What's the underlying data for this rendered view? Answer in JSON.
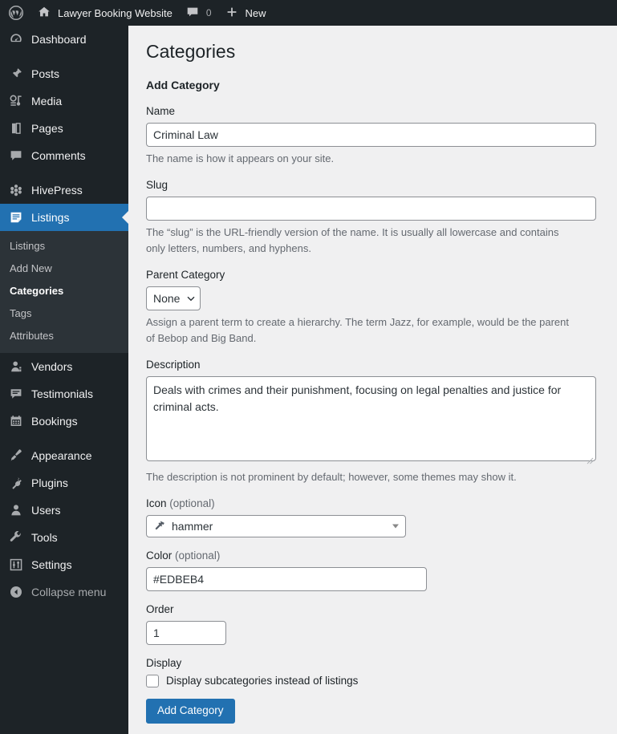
{
  "adminbar": {
    "logo_icon": "wordpress-logo-icon",
    "site_icon": "home-icon",
    "site_name": "Lawyer Booking Website",
    "comments_icon": "comment-bubble-icon",
    "comments_count": "0",
    "new_icon": "plus-icon",
    "new_label": "New"
  },
  "sidebar": {
    "items": [
      {
        "label": "Dashboard",
        "icon": "dashboard-icon",
        "active": false,
        "sep_after": true
      },
      {
        "label": "Posts",
        "icon": "pin-icon",
        "active": false,
        "sep_after": false
      },
      {
        "label": "Media",
        "icon": "media-icon",
        "active": false,
        "sep_after": false
      },
      {
        "label": "Pages",
        "icon": "pages-icon",
        "active": false,
        "sep_after": false
      },
      {
        "label": "Comments",
        "icon": "comment-bubble-icon",
        "active": false,
        "sep_after": true
      },
      {
        "label": "HivePress",
        "icon": "hivepress-icon",
        "active": false,
        "sep_after": false
      },
      {
        "label": "Listings",
        "icon": "listings-icon",
        "active": true,
        "sep_after": false
      }
    ],
    "submenu": [
      {
        "label": "Listings",
        "current": false
      },
      {
        "label": "Add New",
        "current": false
      },
      {
        "label": "Categories",
        "current": true
      },
      {
        "label": "Tags",
        "current": false
      },
      {
        "label": "Attributes",
        "current": false
      }
    ],
    "items_lower": [
      {
        "label": "Vendors",
        "icon": "vendor-icon",
        "sep_after": false
      },
      {
        "label": "Testimonials",
        "icon": "testimonials-icon",
        "sep_after": false
      },
      {
        "label": "Bookings",
        "icon": "calendar-icon",
        "sep_after": true
      },
      {
        "label": "Appearance",
        "icon": "brush-icon",
        "sep_after": false
      },
      {
        "label": "Plugins",
        "icon": "plug-icon",
        "sep_after": false
      },
      {
        "label": "Users",
        "icon": "user-icon",
        "sep_after": false
      },
      {
        "label": "Tools",
        "icon": "wrench-icon",
        "sep_after": false
      },
      {
        "label": "Settings",
        "icon": "sliders-icon",
        "sep_after": false
      },
      {
        "label": "Collapse menu",
        "icon": "collapse-arrow-icon",
        "sep_after": false
      }
    ]
  },
  "page": {
    "title": "Categories",
    "section_title": "Add Category"
  },
  "form": {
    "name": {
      "label": "Name",
      "value": "Criminal Law",
      "description": "The name is how it appears on your site."
    },
    "slug": {
      "label": "Slug",
      "value": "",
      "description": "The “slug” is the URL-friendly version of the name. It is usually all lowercase and contains only letters, numbers, and hyphens."
    },
    "parent": {
      "label": "Parent Category",
      "value": "None",
      "options": [
        "None"
      ],
      "description": "Assign a parent term to create a hierarchy. The term Jazz, for example, would be the parent of Bebop and Big Band."
    },
    "description_field": {
      "label": "Description",
      "value": "Deals with crimes and their punishment, focusing on legal penalties and justice for criminal acts.",
      "description": "The description is not prominent by default; however, some themes may show it."
    },
    "icon": {
      "label": "Icon",
      "optional_suffix": "(optional)",
      "value": "hammer",
      "glyph": "hammer-icon"
    },
    "color": {
      "label": "Color",
      "optional_suffix": "(optional)",
      "value": "#EDBEB4"
    },
    "order": {
      "label": "Order",
      "value": "1"
    },
    "display": {
      "label": "Display",
      "checkbox_label": "Display subcategories instead of listings",
      "checked": false
    },
    "submit_label": "Add Category"
  },
  "colors": {
    "accent": "#2271b1",
    "sidebar_bg": "#1d2327",
    "submenu_bg": "#2c3338",
    "content_bg": "#f0f0f1"
  }
}
